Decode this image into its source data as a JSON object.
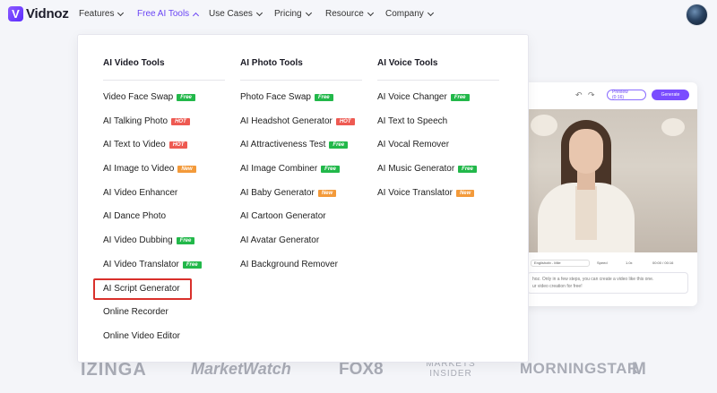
{
  "header": {
    "brand": "Vidnoz",
    "brand_mark": "V",
    "nav": [
      {
        "label": "Features",
        "active": false
      },
      {
        "label": "Free AI Tools",
        "active": true
      },
      {
        "label": "Use Cases",
        "active": false
      },
      {
        "label": "Pricing",
        "active": false
      },
      {
        "label": "Resource",
        "active": false
      },
      {
        "label": "Company",
        "active": false
      }
    ]
  },
  "colors": {
    "accent": "#6a45f5",
    "badge_free": "#22b84a",
    "badge_hot": "#ee5a52",
    "badge_new": "#f39a3a",
    "highlight": "#d9302b"
  },
  "menu": {
    "columns": [
      {
        "title": "AI Video Tools",
        "items": [
          {
            "label": "Video Face Swap",
            "badge": "Free"
          },
          {
            "label": "AI Talking Photo",
            "badge": "HOT"
          },
          {
            "label": "AI Text to Video",
            "badge": "HOT"
          },
          {
            "label": "AI Image to Video",
            "badge": "New"
          },
          {
            "label": "AI Video Enhancer",
            "badge": ""
          },
          {
            "label": "AI Dance Photo",
            "badge": ""
          },
          {
            "label": "AI Video Dubbing",
            "badge": "Free"
          },
          {
            "label": "AI Video Translator",
            "badge": "Free"
          },
          {
            "label": "AI Script Generator",
            "badge": "",
            "highlighted": true
          },
          {
            "label": "Online Recorder",
            "badge": ""
          },
          {
            "label": "Online Video Editor",
            "badge": ""
          }
        ]
      },
      {
        "title": "AI Photo Tools",
        "items": [
          {
            "label": "Photo Face Swap",
            "badge": "Free"
          },
          {
            "label": "AI Headshot Generator",
            "badge": "HOT"
          },
          {
            "label": "AI Attractiveness Test",
            "badge": "Free"
          },
          {
            "label": "AI Image Combiner",
            "badge": "Free"
          },
          {
            "label": "AI Baby Generator",
            "badge": "New"
          },
          {
            "label": "AI Cartoon Generator",
            "badge": ""
          },
          {
            "label": "AI Avatar Generator",
            "badge": ""
          },
          {
            "label": "AI Background Remover",
            "badge": ""
          }
        ]
      },
      {
        "title": "AI Voice Tools",
        "items": [
          {
            "label": "AI Voice Changer",
            "badge": "Free"
          },
          {
            "label": "AI Text to Speech",
            "badge": ""
          },
          {
            "label": "AI Vocal Remover",
            "badge": ""
          },
          {
            "label": "AI Music Generator",
            "badge": "Free"
          },
          {
            "label": "AI Voice Translator",
            "badge": "New"
          }
        ]
      }
    ]
  },
  "editor_preview": {
    "preview_label": "Preview (0:16)",
    "generate_label": "Generate",
    "voice": "Englishotb - Mile",
    "speed_label": "Speed",
    "speed_value": "1.0x",
    "time": "00:00 / 00:16",
    "script_line1": "hoz. Only in a few steps, you can create a video like this one.",
    "script_line2": "ur video creation for free!"
  },
  "press_logos": [
    "IZINGA",
    "MarketWatch",
    "FOX8",
    "MARKETS INSIDER",
    "MORNINGSTAR",
    "M"
  ]
}
